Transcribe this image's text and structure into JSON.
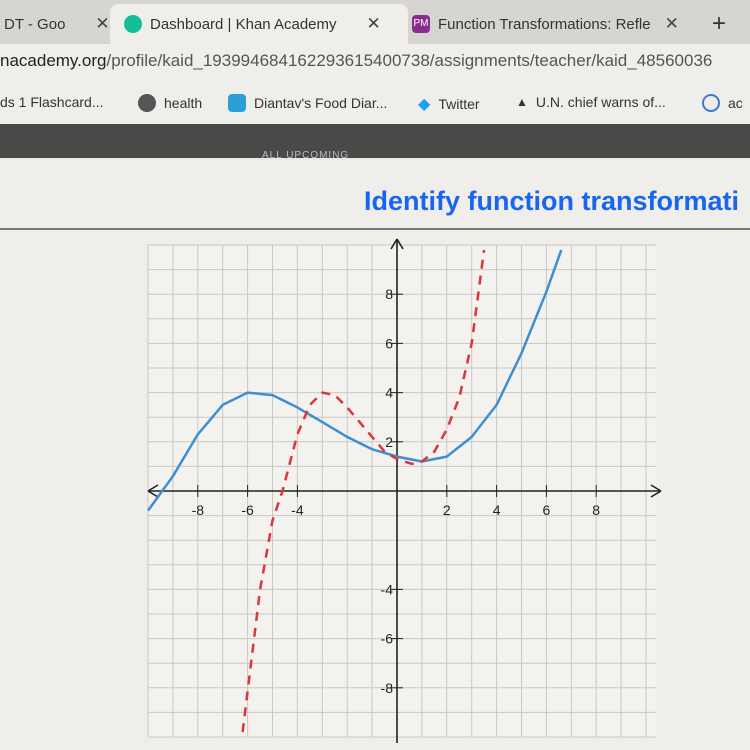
{
  "browser": {
    "tabs": [
      {
        "label": "DT - Goo",
        "active": false
      },
      {
        "label": "Dashboard | Khan Academy",
        "active": true
      },
      {
        "label": "Function Transformations: Refle",
        "active": false,
        "favicon_text": "PM"
      }
    ],
    "new_tab": "+",
    "close": "✕",
    "url_host": "nacademy.org",
    "url_path": "/profile/kaid_193994684162293615400738/assignments/teacher/kaid_48560036",
    "bookmarks": [
      "ds 1 Flashcard...",
      "health",
      "Diantav's Food Diar...",
      "Twitter",
      "U.N. chief warns of...",
      "ac"
    ]
  },
  "page": {
    "subnav": "ALL UPCOMING",
    "title": "Identify function transformati"
  },
  "colors": {
    "accent": "#1865f2",
    "blue_curve": "#3d8fd1",
    "red_curve": "#d9363e"
  },
  "chart_data": {
    "type": "line",
    "xlim": [
      -10,
      10.4
    ],
    "ylim": [
      -10,
      10
    ],
    "grid": true,
    "x_ticks": [
      -8,
      -6,
      -4,
      2,
      4,
      6,
      8
    ],
    "y_ticks": [
      8,
      6,
      4,
      2,
      -4,
      -6,
      -8
    ],
    "series": [
      {
        "style": "solid",
        "color": "#3d8fd1",
        "points": [
          [
            -10,
            -0.8
          ],
          [
            -9,
            0.6
          ],
          [
            -8,
            2.3
          ],
          [
            -7,
            3.5
          ],
          [
            -6,
            4
          ],
          [
            -5,
            3.9
          ],
          [
            -4,
            3.4
          ],
          [
            -3,
            2.8
          ],
          [
            -2,
            2.2
          ],
          [
            -1,
            1.7
          ],
          [
            0,
            1.4
          ],
          [
            1,
            1.2
          ],
          [
            2,
            1.4
          ],
          [
            3,
            2.2
          ],
          [
            4,
            3.5
          ],
          [
            5,
            5.6
          ],
          [
            6,
            8.1
          ],
          [
            6.6,
            9.8
          ]
        ]
      },
      {
        "style": "dashed",
        "color": "#d9363e",
        "points": [
          [
            -6.2,
            -9.8
          ],
          [
            -5.5,
            -4
          ],
          [
            -5,
            -1.2
          ],
          [
            -4.6,
            0
          ],
          [
            -4,
            2.3
          ],
          [
            -3.5,
            3.5
          ],
          [
            -3,
            4
          ],
          [
            -2.5,
            3.9
          ],
          [
            -2,
            3.4
          ],
          [
            -1.5,
            2.8
          ],
          [
            -1,
            2.2
          ],
          [
            -0.5,
            1.6
          ],
          [
            0,
            1.3
          ],
          [
            0.6,
            1.1
          ],
          [
            1,
            1.2
          ],
          [
            1.5,
            1.6
          ],
          [
            2,
            2.5
          ],
          [
            2.5,
            3.8
          ],
          [
            3,
            6
          ],
          [
            3.5,
            9.8
          ]
        ]
      }
    ]
  }
}
